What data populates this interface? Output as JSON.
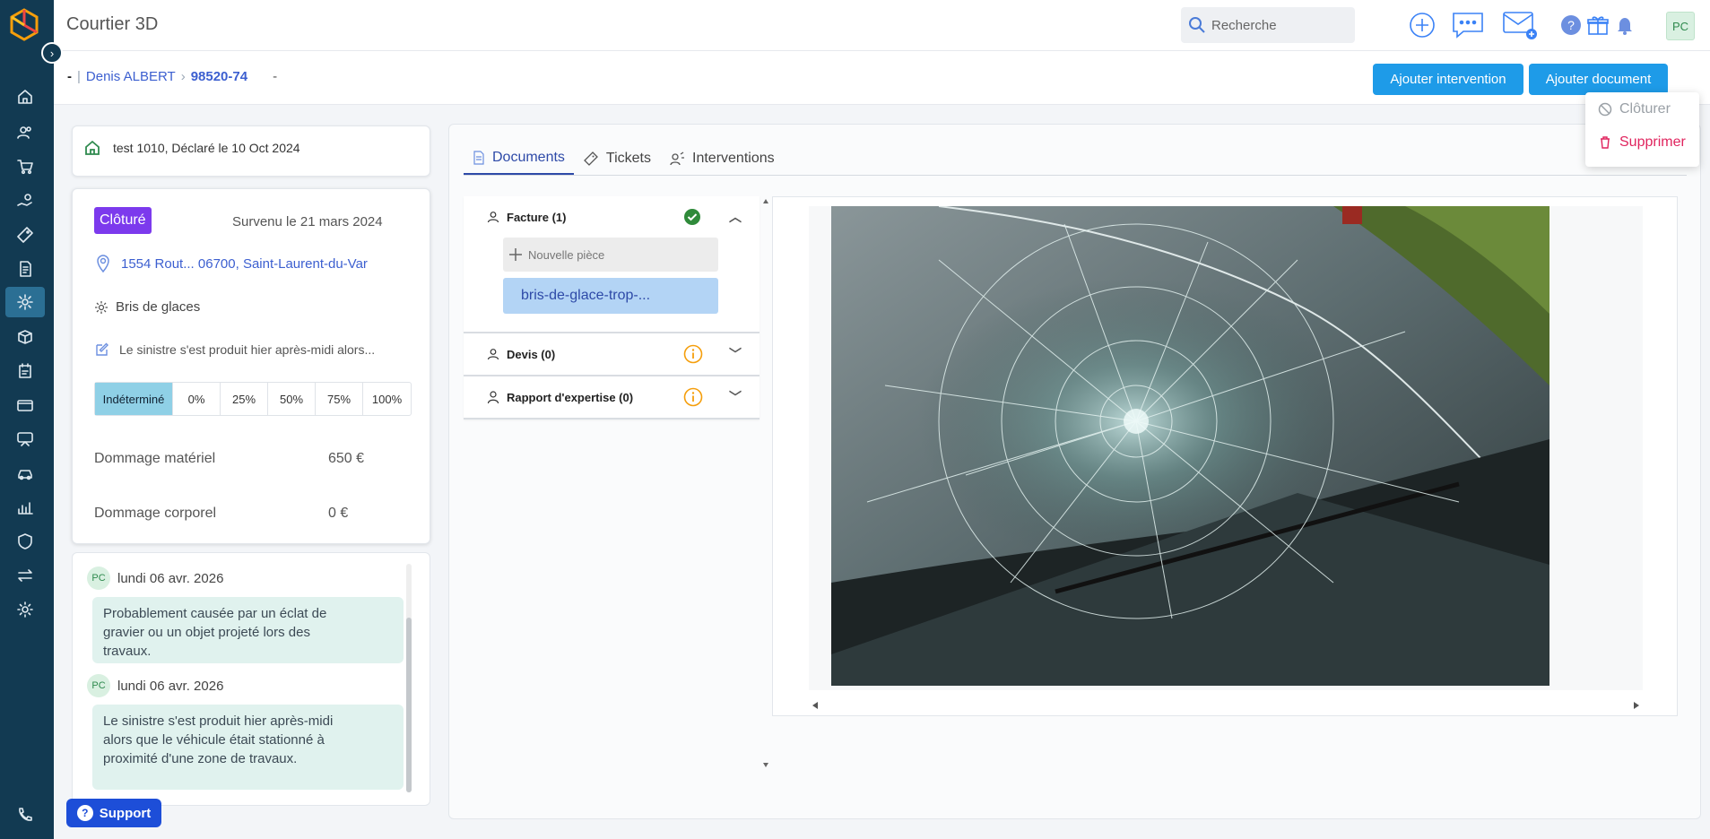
{
  "app": {
    "title": "Courtier 3D"
  },
  "search": {
    "placeholder": "Recherche"
  },
  "user": {
    "initials": "PC"
  },
  "breadcrumb": {
    "dash": "-",
    "sep": "|",
    "client": "Denis ALBERT",
    "arrow": "›",
    "claim_number": "98520-74",
    "extra": "-"
  },
  "actions": {
    "add_intervention": "Ajouter intervention",
    "add_document": "Ajouter document"
  },
  "menu": {
    "close": "Clôturer",
    "delete": "Supprimer"
  },
  "declared": {
    "text": "test 1010, Déclaré le 10 Oct 2024"
  },
  "claim": {
    "status": "Clôturé",
    "occurred": "Survenu le 21 mars 2024",
    "address": "1554 Rout...  06700, Saint-Laurent-du-Var",
    "type": "Bris de glaces",
    "description": "Le sinistre s'est produit hier après-midi alors...",
    "percent_options": [
      "Indéterminé",
      "0%",
      "25%",
      "50%",
      "75%",
      "100%"
    ],
    "selected_percent": "Indéterminé",
    "damage_material_label": "Dommage matériel",
    "damage_material_value": "650 €",
    "damage_bodily_label": "Dommage corporel",
    "damage_bodily_value": "0 €"
  },
  "notes": [
    {
      "author": "PC",
      "date": "lundi 06 avr. 2026",
      "text": "Probablement causée par un éclat de gravier ou un objet projeté lors des travaux."
    },
    {
      "author": "PC",
      "date": "lundi 06 avr. 2026",
      "text": "Le sinistre s'est produit hier après-midi alors que le véhicule était stationné à proximité d'une zone de travaux."
    }
  ],
  "support": {
    "label": "Support"
  },
  "tabs": [
    "Documents",
    "Tickets",
    "Interventions"
  ],
  "doc_groups": [
    {
      "label": "Facture (1)",
      "status": "ok"
    },
    {
      "label": "Devis (0)",
      "status": "info"
    },
    {
      "label": "Rapport d'expertise (0)",
      "status": "info"
    }
  ],
  "new_piece": "Nouvelle pièce",
  "file": {
    "name": "bris-de-glace-trop-..."
  },
  "colors": {
    "sidebar": "#123a52",
    "primary": "#1e9be8",
    "badge": "#7c3aed",
    "link": "#3c5fd0",
    "danger": "#e0245e"
  }
}
